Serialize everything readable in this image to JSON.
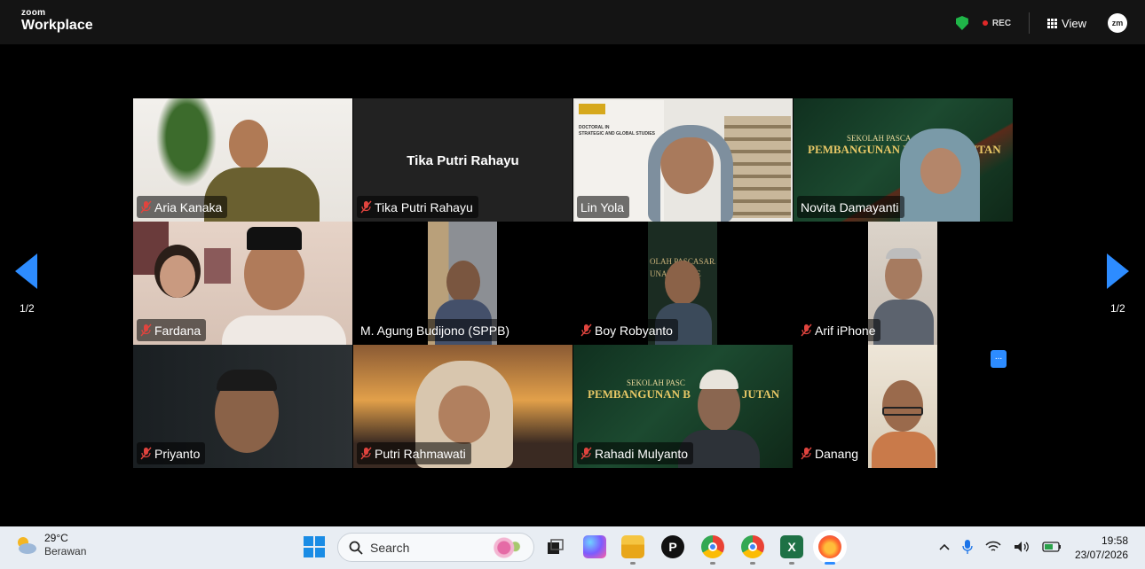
{
  "app": {
    "brand_small": "zoom",
    "brand_big": "Workplace"
  },
  "topbar": {
    "rec_label": "REC",
    "view_label": "View",
    "avatar_initials": "zm"
  },
  "pagination": {
    "left_label": "1/2",
    "right_label": "1/2"
  },
  "participants": [
    {
      "name": "Aria Kanaka",
      "muted": true,
      "video": true
    },
    {
      "name": "Tika Putri Rahayu",
      "muted": true,
      "video": false
    },
    {
      "name": "Lin Yola",
      "muted": false,
      "video": true,
      "active_speaker": true
    },
    {
      "name": "Novita Damayanti",
      "muted": false,
      "video": true
    },
    {
      "name": "Fardana",
      "muted": true,
      "video": true
    },
    {
      "name": "M. Agung Budijono (SPPB)",
      "muted": false,
      "video": true
    },
    {
      "name": "Boy Robyanto",
      "muted": true,
      "video": true
    },
    {
      "name": "Arif iPhone",
      "muted": true,
      "video": true
    },
    {
      "name": "Priyanto",
      "muted": true,
      "video": true
    },
    {
      "name": "Putri Rahmawati",
      "muted": true,
      "video": true
    },
    {
      "name": "Rahadi Mulyanto",
      "muted": true,
      "video": true
    },
    {
      "name": "Danang",
      "muted": true,
      "video": true
    }
  ],
  "backgrounds": {
    "lin_slide_line1": "DOCTORAL IN",
    "lin_slide_line2": "STRATEGIC AND GLOBAL STUDIES",
    "novita_slide_line1": "SEKOLAH PASCA",
    "novita_slide_line2": "PEMBANGUNAN B",
    "novita_slide_line2b": "NJUTAN",
    "rahadi_slide_line1": "SEKOLAH PASC",
    "rahadi_slide_line2": "PEMBANGUNAN B",
    "rahadi_slide_line2b": "JUTAN"
  },
  "more_button": "...",
  "taskbar": {
    "temperature": "29°C",
    "weather_desc": "Berawan",
    "search_placeholder": "Search",
    "time": "19:58",
    "date": "23/07/2026"
  },
  "colors": {
    "accent": "#2d8cff",
    "active_speaker": "#2fd35a",
    "rec": "#e02828",
    "shield": "#1fb548"
  }
}
